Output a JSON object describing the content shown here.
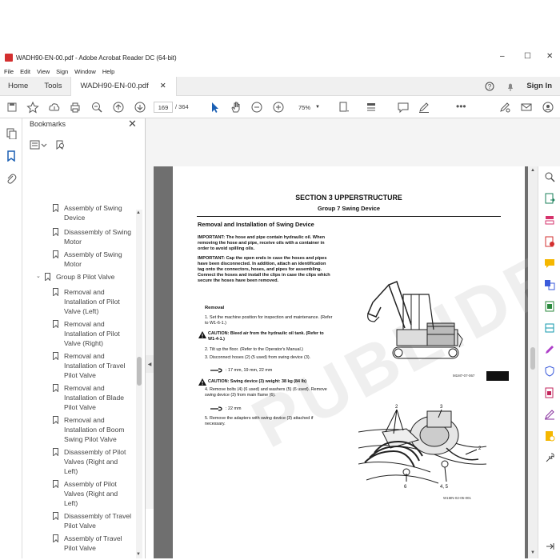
{
  "window": {
    "title": "WADH90-EN-00.pdf - Adobe Acrobat Reader DC (64-bit)",
    "min": "–",
    "max": "☐",
    "close": "✕"
  },
  "menu": [
    "File",
    "Edit",
    "View",
    "Sign",
    "Window",
    "Help"
  ],
  "tabs": {
    "home": "Home",
    "tools": "Tools",
    "doc": "WADH90-EN-00.pdf",
    "doc_close": "✕",
    "signin": "Sign In"
  },
  "toolbar": {
    "page_current": "169",
    "page_total": "/ 364",
    "zoom": "75%"
  },
  "bookmarks": {
    "title": "Bookmarks",
    "items": [
      {
        "label": "Assembly of Swing\nDevice"
      },
      {
        "label": "Disassembly of Swing\nMotor"
      },
      {
        "label": "Assembly of Swing\nMotor"
      },
      {
        "label": "Group 8 Pilot Valve"
      },
      {
        "label": "Removal and\nInstallation of Pilot\nValve (Left)"
      },
      {
        "label": "Removal and\nInstallation of Pilot\nValve (Right)"
      },
      {
        "label": "Removal and\nInstallation of Travel\nPilot Valve"
      },
      {
        "label": "Removal and\nInstallation of Blade\nPilot Valve"
      },
      {
        "label": "Removal and\nInstallation of Boom\nSwing Pilot Valve"
      },
      {
        "label": "Disassembly of Pilot\nValves (Right and\nLeft)"
      },
      {
        "label": "Assembly of Pilot\nValves (Right and\nLeft)"
      },
      {
        "label": "Disassembly of Travel\nPilot Valve"
      },
      {
        "label": "Assembly of Travel\nPilot Valve"
      }
    ]
  },
  "doc": {
    "section": "SECTION 3 UPPERSTRUCTURE",
    "group": "Group 7 Swing Device",
    "heading": "Removal and Installation of Swing Device",
    "important1_tag": "IMPORTANT:",
    "important1": "The hose and pipe contain hydraulic oil. When removing the hose and pipe, receive oils with a container in order to avoid spilling oils.",
    "important2_tag": "IMPORTANT:",
    "important2": "Cap the open ends in case the hoses and pipes have been disconnected. In addition, attach an identification tag onto the connectors, hoses, and pipes for assembling. Connect the hoses and install the clips in case the clips which secure the hoses have been removed.",
    "removal": "Removal",
    "step1": "1.  Set the machine position for inspection and maintenance. (Refer to W1-6-1.)",
    "caution1": "CAUTION:   Bleed air from the hydraulic oil tank. (Refer to W1-4-1.)",
    "step2": "2.  Tilt up the floor. (Refer to the Operator's Manual.)",
    "step3": "3.  Disconnect hoses (2) (5 used) from swing device (3).",
    "wrench1": ": 17 mm, 19 mm, 22 mm",
    "caution2": "CAUTION:   Swing device (3) weight: 38 kg (84 lb)",
    "step4": "4.  Remove bolts (4) (6 used) and washers (5) (6 used). Remove swing device (3) from main flame (6).",
    "wrench2": ": 22 mm",
    "step5": "5.  Remove the adapters with swing device (3) attached if necessary.",
    "fig1_caption": "M1M7-07-067",
    "fig2_caption": "W1MN-02-05-001",
    "fig2_labels": [
      "2",
      "3",
      "2",
      "6",
      "4, 5"
    ],
    "watermark": "PUBLIDEPO.COM"
  }
}
